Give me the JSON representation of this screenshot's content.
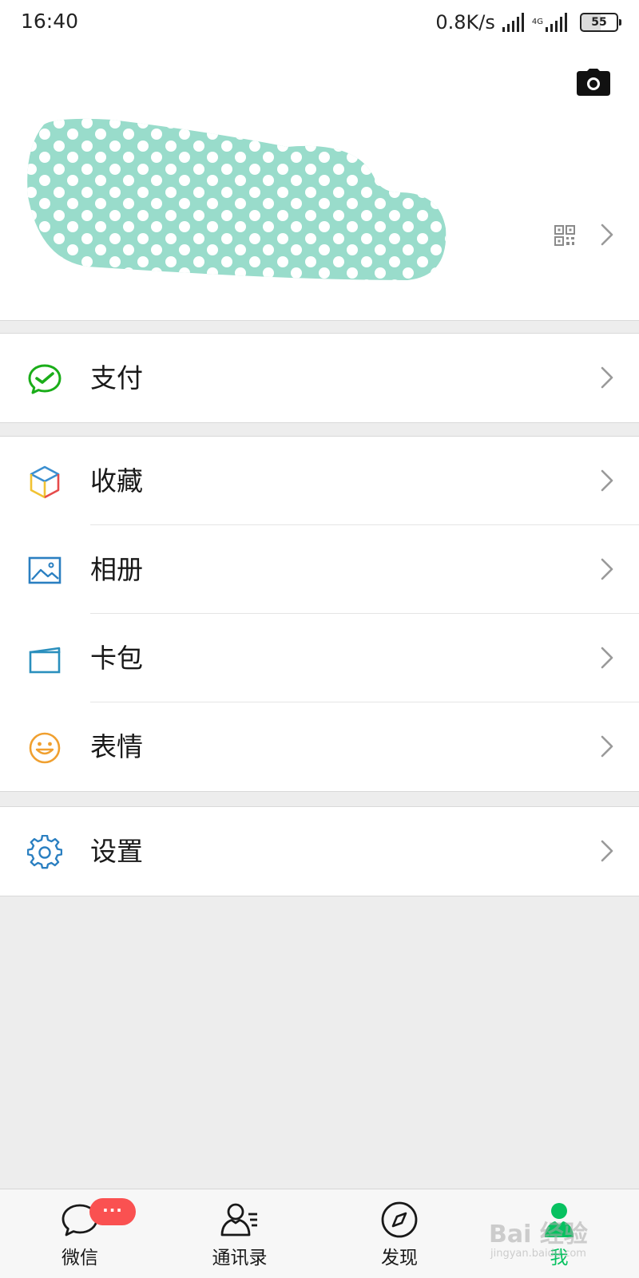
{
  "status_bar": {
    "time": "16:40",
    "net_speed": "0.8K/s",
    "network_type": "4G",
    "battery": "55"
  },
  "profile": {
    "camera_icon": "camera-icon",
    "qr_icon": "qr-code-icon"
  },
  "menu": {
    "pay": {
      "label": "支付",
      "icon": "wechat-pay-icon",
      "color": "#1aad19"
    },
    "favorites": {
      "label": "收藏",
      "icon": "cube-icon"
    },
    "album": {
      "label": "相册",
      "icon": "album-icon",
      "color": "#2a7fc1"
    },
    "cards": {
      "label": "卡包",
      "icon": "card-wallet-icon",
      "color": "#2a8fbd"
    },
    "stickers": {
      "label": "表情",
      "icon": "smiley-icon",
      "color": "#f0a030"
    },
    "settings": {
      "label": "设置",
      "icon": "gear-icon",
      "color": "#2a7fc1"
    }
  },
  "tabbar": {
    "chats": {
      "label": "微信",
      "badge": "···"
    },
    "contacts": {
      "label": "通讯录"
    },
    "discover": {
      "label": "发现"
    },
    "me": {
      "label": "我",
      "active": true
    }
  },
  "colors": {
    "accent": "#07c160",
    "badge": "#fa5151",
    "background": "#ededed",
    "mosaic": "#99dccb"
  },
  "watermark": {
    "text": "Bai 经验",
    "sub": "jingyan.baidu.com"
  }
}
